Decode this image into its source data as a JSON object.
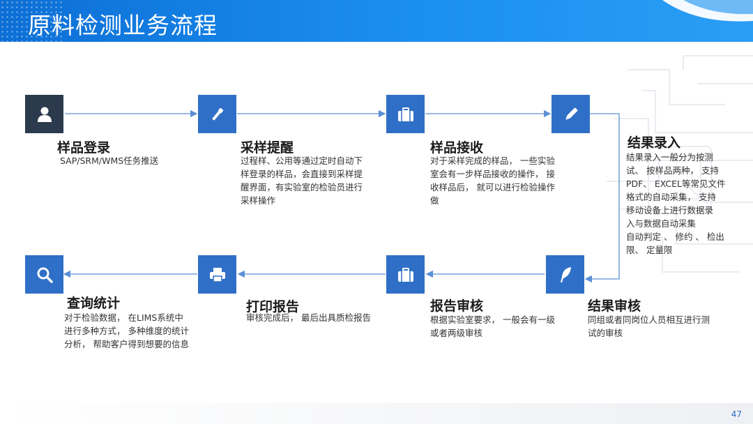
{
  "header": {
    "title": "原料检测业务流程"
  },
  "page_number": "47",
  "steps": [
    {
      "title": "样品登录",
      "desc": [
        "SAP/SRM/WMS任务推送"
      ]
    },
    {
      "title": "采样提醒",
      "desc": [
        "过程样、公用等通过定时自动下",
        "样登录的样品，会直接到采样提",
        "醒界面，有实验室的检验员进行",
        "采样操作"
      ]
    },
    {
      "title": "样品接收",
      "desc": [
        "对于采样完成的样品， 一些实验",
        "室会有一步样品接收的操作， 接",
        "收样品后， 就可以进行检验操作",
        "做"
      ]
    },
    {
      "title": "结果录入",
      "desc": [
        "结果录入一般分为按测",
        "试、 按样品两种， 支持",
        "PDF、 EXCEL等常见文件",
        "格式的自动采集， 支持",
        "移动设备上进行数据录",
        "入与数据自动采集",
        "自动判定 、 修约 、 检出",
        "限、 定量限"
      ]
    },
    {
      "title": "结果审核",
      "desc": [
        "同组或者同岗位人员相互进行测",
        "试的审核"
      ]
    },
    {
      "title": "报告审核",
      "desc": [
        "根据实验室要求， 一般会有一级",
        "或者两级审核"
      ]
    },
    {
      "title": "打印报告",
      "desc": [
        "审核完成后， 最后出具质检报告"
      ]
    },
    {
      "title": "查询统计",
      "desc": [
        "对于检验数据， 在LIMS系统中",
        "进行多种方式， 多种维度的统计",
        "分析， 帮助客户得到想要的信息"
      ]
    }
  ],
  "icons": [
    "user-icon",
    "flashlight-icon",
    "briefcase-icon",
    "pencil-icon",
    "quill-icon",
    "briefcase-icon",
    "printer-icon",
    "search-icon"
  ],
  "colors": {
    "header": "#1b8ff0",
    "icon_blue": "#2f6fc7",
    "icon_dark": "#2b3a4d",
    "arrow": "#5b8fd6"
  }
}
